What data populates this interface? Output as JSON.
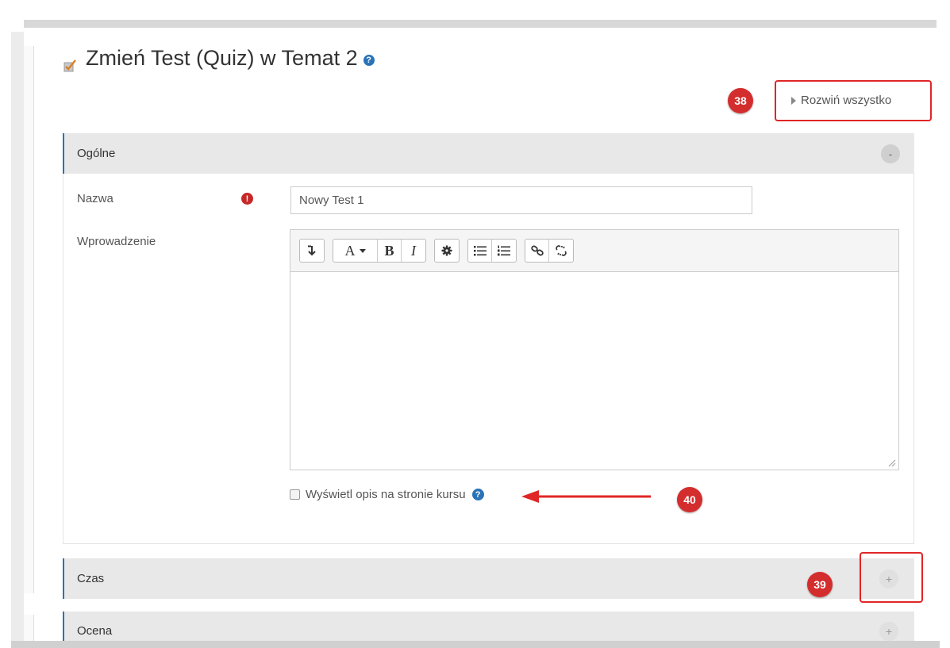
{
  "page": {
    "title": "Zmień Test (Quiz) w Temat 2"
  },
  "expand_all": {
    "label": "Rozwiń wszystko"
  },
  "annotations": {
    "badge_38": "38",
    "badge_39": "39",
    "badge_40": "40"
  },
  "sections": {
    "general": {
      "title": "Ogólne",
      "toggle": "-"
    },
    "time": {
      "title": "Czas",
      "toggle": "+"
    },
    "grade": {
      "title": "Ocena",
      "toggle": "+"
    }
  },
  "form": {
    "name_label": "Nazwa",
    "name_value": "Nowy Test 1",
    "intro_label": "Wprowadzenie",
    "show_description_label": "Wyświetl opis na stronie kursu"
  },
  "editor_toolbar": {
    "expand_icon": "↕",
    "font": "A",
    "bold": "B",
    "italic": "I"
  },
  "colors": {
    "accent": "#2a73b8",
    "annotation_red": "#d42d2d",
    "required": "#c62828"
  }
}
